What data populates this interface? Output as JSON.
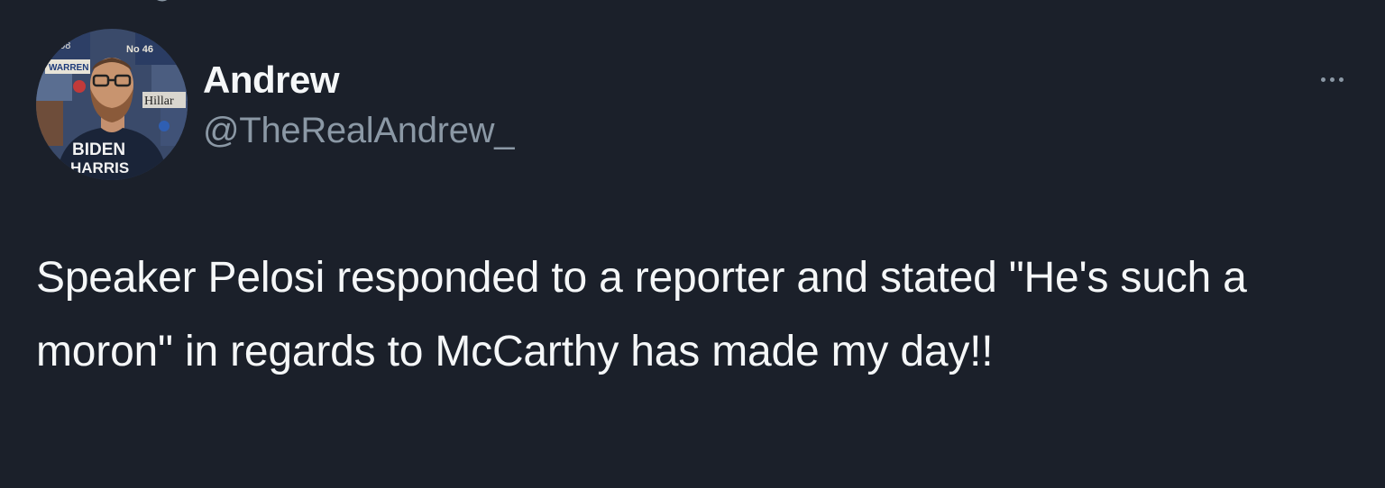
{
  "author": {
    "display_name": "Andrew",
    "handle": "@TheRealAndrew_",
    "avatar": {
      "icon": "profile-photo",
      "shirt_text": [
        "BIDEN",
        "HARRIS"
      ],
      "background_text": [
        "WARREN",
        "Hillar",
        "'08",
        "No 46"
      ]
    }
  },
  "menu": {
    "more_icon": "more-horizontal-icon"
  },
  "tweet": {
    "text": "Speaker Pelosi responded to a reporter and stated \"He's such a moron\" in regards to McCarthy has made my day!!"
  },
  "colors": {
    "background": "#1b202a",
    "primary_text": "#f5f7f8",
    "secondary_text": "#8b98a5"
  }
}
